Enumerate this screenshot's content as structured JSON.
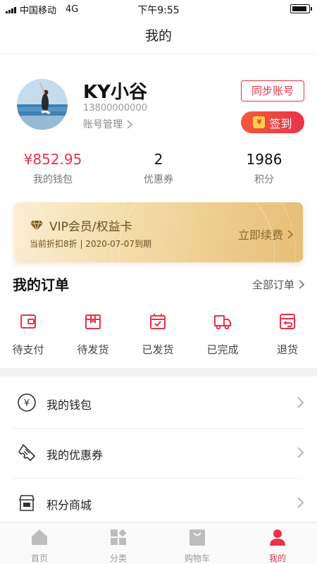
{
  "status_bar": {
    "carrier": "中国移动",
    "network": "4G",
    "time": "下午9:55"
  },
  "nav": {
    "title": "我的"
  },
  "profile": {
    "name": "KY小谷",
    "phone": "13800000000",
    "account_link": "账号管理",
    "sync_button": "同步账号",
    "signin_button": "签到",
    "signin_icon_text": "¥"
  },
  "stats": [
    {
      "value": "¥852.95",
      "label": "我的钱包"
    },
    {
      "value": "2",
      "label": "优惠券"
    },
    {
      "value": "1986",
      "label": "积分"
    }
  ],
  "vip": {
    "title": "VIP会员/权益卡",
    "subtitle": "当前折扣8折 | 2020-07-07到期",
    "renew": "立即续费"
  },
  "orders": {
    "title": "我的订单",
    "all": "全部订单",
    "items": [
      {
        "label": "待支付",
        "icon": "wallet-icon"
      },
      {
        "label": "待发货",
        "icon": "box-icon"
      },
      {
        "label": "已发货",
        "icon": "calendar-check-icon"
      },
      {
        "label": "已完成",
        "icon": "truck-icon"
      },
      {
        "label": "退货",
        "icon": "return-icon"
      }
    ]
  },
  "menu": [
    {
      "label": "我的钱包",
      "icon": "yuan-circle-icon"
    },
    {
      "label": "我的优惠券",
      "icon": "ticket-icon"
    },
    {
      "label": "积分商城",
      "icon": "shop-icon"
    }
  ],
  "tabs": [
    {
      "label": "首页",
      "icon": "home-icon"
    },
    {
      "label": "分类",
      "icon": "category-icon"
    },
    {
      "label": "购物车",
      "icon": "cart-icon"
    },
    {
      "label": "我的",
      "icon": "user-icon",
      "active": true
    }
  ],
  "colors": {
    "accent": "#e8334a",
    "gold_text": "#6b4f22",
    "tab_inactive": "#999999"
  }
}
